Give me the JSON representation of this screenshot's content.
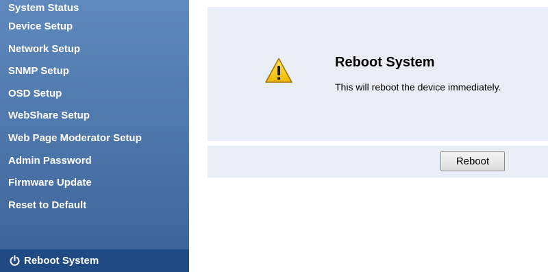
{
  "sidebar": {
    "items": [
      {
        "label": "System Status"
      },
      {
        "label": "Device Setup"
      },
      {
        "label": "Network Setup"
      },
      {
        "label": "SNMP Setup"
      },
      {
        "label": "OSD Setup"
      },
      {
        "label": "WebShare Setup"
      },
      {
        "label": "Web Page Moderator Setup"
      },
      {
        "label": "Admin Password"
      },
      {
        "label": "Firmware Update"
      },
      {
        "label": "Reset to Default"
      }
    ],
    "active": {
      "label": "Reboot System",
      "icon": "power-icon"
    },
    "colors": {
      "background": "#4f78ad",
      "active_background": "#1f4a84",
      "text": "#ffffff"
    }
  },
  "main": {
    "icon": "warning-icon",
    "title": "Reboot System",
    "message": "This will reboot the device immediately.",
    "reboot_button_label": "Reboot",
    "colors": {
      "panel_background": "#e9edf5",
      "warning": "#f5c400"
    }
  }
}
